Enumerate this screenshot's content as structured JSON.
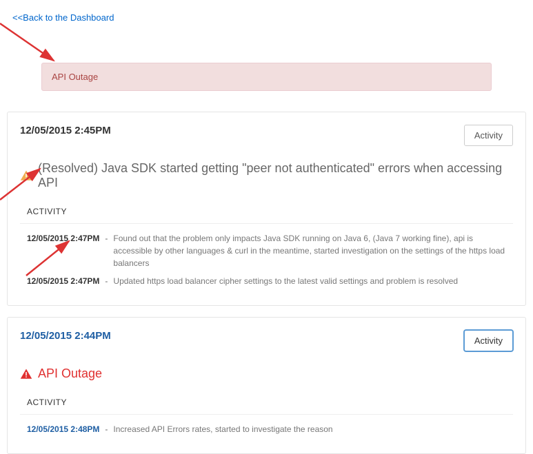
{
  "back_link": "<<Back to the Dashboard",
  "alert_banner": {
    "text": "API Outage"
  },
  "cards": [
    {
      "timestamp": "12/05/2015 2:45PM",
      "timestamp_style": "default",
      "button_label": "Activity",
      "button_active": false,
      "severity": "warning",
      "title": "(Resolved) Java SDK started getting \"peer not authenticated\" errors when accessing API",
      "section_label": "ACTIVITY",
      "entries": [
        {
          "time": "12/05/2015 2:47PM",
          "time_style": "default",
          "text": "Found out that the problem only impacts Java SDK running on Java 6, (Java 7 working fine), api is accessible by other languages & curl in the meantime, started investigation on the settings of the https load balancers"
        },
        {
          "time": "12/05/2015 2:47PM",
          "time_style": "default",
          "text": "Updated https load balancer cipher settings to the latest valid settings and problem is resolved"
        }
      ]
    },
    {
      "timestamp": "12/05/2015 2:44PM",
      "timestamp_style": "blue",
      "button_label": "Activity",
      "button_active": true,
      "severity": "error",
      "title": "API Outage",
      "section_label": "ACTIVITY",
      "entries": [
        {
          "time": "12/05/2015 2:48PM",
          "time_style": "blue",
          "text": "Increased API Errors rates, started to investigate the reason"
        }
      ]
    }
  ],
  "icons": {
    "warning_color": "#f0ad4e",
    "error_color": "#e03030"
  }
}
